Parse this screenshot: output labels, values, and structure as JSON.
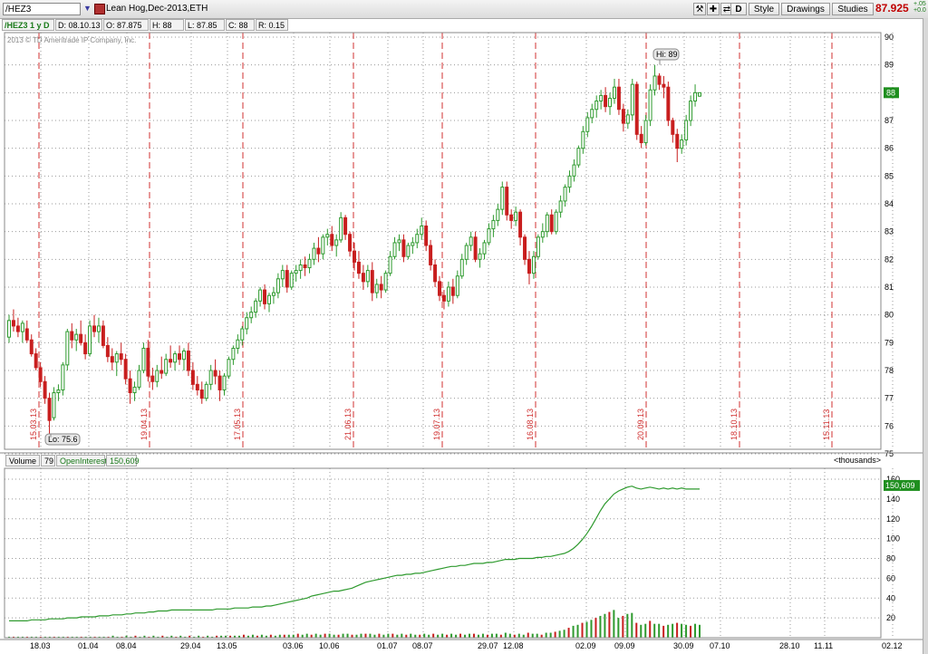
{
  "toolbar": {
    "symbol": "/HEZ3",
    "description": "Lean Hog,Dec-2013,ETH",
    "d_label": "D",
    "style_label": "Style",
    "drawings_label": "Drawings",
    "studies_label": "Studies",
    "last_price": "87.925",
    "change_top": "+.05",
    "change_bottom": "+0.0"
  },
  "info_bar": {
    "title": "/HEZ3 1 y D",
    "date": "D: 08.10.13",
    "open": "O: 87.875",
    "high": "H: 88",
    "low": "L: 87.85",
    "close": "C: 88",
    "range": "R: 0.15"
  },
  "copyright": "2013 © TD Ameritrade IP Company, Inc.",
  "price_panel": {
    "y_ticks": [
      "90",
      "89",
      "88",
      "87",
      "86",
      "85",
      "84",
      "83",
      "82",
      "81",
      "80",
      "79",
      "78",
      "77",
      "76",
      "75"
    ],
    "current_badge": "88",
    "hi_label": "Hi: 89",
    "lo_label": "Lo: 75.6",
    "expiry_labels": [
      "15.03.13",
      "19.04.13",
      "17.05.13",
      "21.06.13",
      "19.07.13",
      "16.08.13",
      "20.09.13",
      "18.10.13",
      "15.11.13"
    ]
  },
  "volume_panel": {
    "volume_label": "Volume",
    "volume_value": "79",
    "oi_label": "OpenInterest",
    "oi_value": "150,609",
    "thousands_label": "<thousands>",
    "oi_badge": "150,609",
    "y_ticks": [
      "160",
      "140",
      "120",
      "100",
      "80",
      "60",
      "40",
      "20"
    ]
  },
  "x_axis": [
    "18.03",
    "01.04",
    "08.04",
    "29.04",
    "13.05",
    "03.06",
    "10.06",
    "01.07",
    "08.07",
    "29.07",
    "12.08",
    "02.09",
    "09.09",
    "30.09",
    "07.10",
    "28.10",
    "11.11",
    "02.12"
  ],
  "colors": {
    "up": "#2e9a2e",
    "down": "#c81e1e",
    "oi_line": "#2e9a2e",
    "expiry": "#d03030",
    "badge": "#1f8f1f"
  },
  "chart_data": {
    "type": "candlestick",
    "price_ylim": [
      75,
      90
    ],
    "oi_ylim": [
      0,
      160
    ],
    "candles": [
      [
        79.2,
        80.0,
        79.0,
        79.8
      ],
      [
        79.8,
        80.2,
        79.4,
        79.6
      ],
      [
        79.6,
        79.9,
        79.2,
        79.4
      ],
      [
        79.4,
        79.8,
        79.0,
        79.7
      ],
      [
        79.5,
        79.8,
        79.0,
        79.1
      ],
      [
        79.1,
        79.3,
        78.5,
        78.6
      ],
      [
        78.6,
        78.8,
        78.0,
        78.1
      ],
      [
        78.1,
        78.3,
        77.4,
        77.6
      ],
      [
        77.6,
        77.8,
        76.8,
        77.0
      ],
      [
        77.0,
        77.2,
        75.6,
        76.2
      ],
      [
        76.3,
        77.4,
        76.2,
        77.2
      ],
      [
        77.2,
        77.5,
        76.9,
        77.3
      ],
      [
        77.3,
        78.3,
        77.1,
        78.2
      ],
      [
        78.2,
        79.5,
        78.0,
        79.4
      ],
      [
        79.4,
        79.7,
        78.8,
        79.1
      ],
      [
        79.1,
        79.5,
        78.7,
        79.3
      ],
      [
        79.3,
        79.8,
        78.9,
        79.0
      ],
      [
        79.0,
        79.3,
        78.4,
        78.6
      ],
      [
        78.6,
        79.8,
        78.5,
        79.6
      ],
      [
        79.6,
        80.0,
        79.2,
        79.4
      ],
      [
        79.4,
        79.9,
        79.0,
        79.6
      ],
      [
        79.6,
        79.8,
        78.8,
        78.9
      ],
      [
        78.9,
        79.2,
        78.3,
        78.5
      ],
      [
        78.5,
        78.8,
        78.0,
        78.3
      ],
      [
        78.3,
        78.7,
        77.8,
        78.6
      ],
      [
        78.6,
        79.0,
        78.2,
        78.4
      ],
      [
        78.4,
        78.6,
        77.5,
        77.7
      ],
      [
        77.7,
        78.0,
        76.8,
        77.2
      ],
      [
        77.2,
        77.6,
        76.9,
        77.4
      ],
      [
        77.4,
        78.2,
        77.3,
        78.0
      ],
      [
        78.0,
        79.0,
        77.9,
        78.8
      ],
      [
        78.8,
        79.1,
        77.6,
        77.8
      ],
      [
        77.8,
        78.1,
        77.3,
        77.6
      ],
      [
        77.6,
        78.2,
        77.4,
        78.0
      ],
      [
        78.0,
        78.5,
        77.7,
        77.9
      ],
      [
        77.9,
        78.6,
        77.8,
        78.4
      ],
      [
        78.4,
        78.9,
        78.1,
        78.3
      ],
      [
        78.3,
        78.7,
        78.0,
        78.6
      ],
      [
        78.6,
        78.9,
        78.2,
        78.4
      ],
      [
        78.4,
        78.8,
        78.0,
        78.7
      ],
      [
        78.7,
        79.0,
        77.8,
        78.0
      ],
      [
        78.0,
        78.3,
        77.3,
        77.5
      ],
      [
        77.5,
        77.8,
        77.1,
        77.3
      ],
      [
        77.3,
        77.6,
        76.8,
        77.0
      ],
      [
        77.0,
        77.6,
        76.9,
        77.5
      ],
      [
        77.5,
        78.2,
        77.3,
        78.0
      ],
      [
        78.0,
        78.4,
        77.5,
        77.8
      ],
      [
        77.8,
        78.0,
        76.9,
        77.3
      ],
      [
        77.3,
        77.9,
        77.1,
        77.8
      ],
      [
        77.8,
        78.5,
        77.7,
        78.4
      ],
      [
        78.4,
        78.9,
        78.2,
        78.8
      ],
      [
        78.8,
        79.3,
        78.6,
        79.1
      ],
      [
        79.1,
        79.6,
        78.9,
        79.5
      ],
      [
        79.5,
        80.1,
        79.3,
        79.9
      ],
      [
        79.9,
        80.3,
        79.7,
        80.1
      ],
      [
        80.1,
        80.6,
        79.9,
        80.5
      ],
      [
        80.5,
        81.0,
        80.3,
        80.9
      ],
      [
        80.9,
        81.1,
        80.2,
        80.4
      ],
      [
        80.4,
        80.8,
        80.1,
        80.7
      ],
      [
        80.7,
        81.0,
        80.4,
        80.8
      ],
      [
        80.8,
        81.5,
        80.6,
        81.3
      ],
      [
        81.3,
        81.8,
        81.0,
        81.6
      ],
      [
        81.6,
        81.8,
        80.8,
        81.0
      ],
      [
        81.0,
        81.6,
        80.9,
        81.5
      ],
      [
        81.5,
        81.8,
        81.2,
        81.6
      ],
      [
        81.6,
        82.0,
        81.3,
        81.8
      ],
      [
        81.8,
        82.1,
        81.4,
        81.7
      ],
      [
        81.7,
        82.2,
        81.5,
        82.0
      ],
      [
        82.0,
        82.6,
        81.8,
        82.4
      ],
      [
        82.4,
        82.8,
        81.9,
        82.2
      ],
      [
        82.2,
        82.9,
        82.0,
        82.8
      ],
      [
        82.8,
        83.1,
        82.5,
        82.9
      ],
      [
        82.9,
        83.2,
        82.3,
        82.5
      ],
      [
        82.5,
        82.9,
        82.1,
        82.7
      ],
      [
        82.7,
        83.7,
        82.6,
        83.5
      ],
      [
        83.5,
        83.6,
        82.7,
        82.9
      ],
      [
        82.9,
        83.0,
        82.1,
        82.3
      ],
      [
        82.3,
        82.6,
        81.6,
        81.9
      ],
      [
        81.9,
        82.3,
        81.3,
        81.5
      ],
      [
        81.5,
        81.8,
        80.9,
        81.2
      ],
      [
        81.2,
        81.8,
        81.0,
        81.6
      ],
      [
        81.6,
        81.9,
        80.5,
        80.8
      ],
      [
        80.8,
        81.3,
        80.6,
        81.1
      ],
      [
        81.1,
        81.4,
        80.6,
        80.9
      ],
      [
        80.9,
        81.6,
        80.8,
        81.5
      ],
      [
        81.5,
        82.3,
        81.4,
        82.1
      ],
      [
        82.1,
        82.8,
        82.0,
        82.6
      ],
      [
        82.6,
        82.9,
        82.3,
        82.7
      ],
      [
        82.7,
        82.9,
        81.9,
        82.1
      ],
      [
        82.1,
        82.6,
        82.0,
        82.5
      ],
      [
        82.5,
        82.8,
        82.2,
        82.6
      ],
      [
        82.6,
        83.1,
        82.4,
        82.9
      ],
      [
        82.9,
        83.5,
        82.7,
        83.2
      ],
      [
        83.2,
        83.4,
        82.3,
        82.5
      ],
      [
        82.5,
        82.7,
        81.6,
        81.8
      ],
      [
        81.8,
        82.0,
        81.0,
        81.2
      ],
      [
        81.2,
        81.4,
        80.5,
        80.7
      ],
      [
        80.7,
        80.9,
        80.2,
        80.5
      ],
      [
        80.5,
        81.2,
        80.3,
        81.0
      ],
      [
        81.0,
        81.3,
        80.4,
        80.7
      ],
      [
        80.7,
        81.6,
        80.6,
        81.4
      ],
      [
        81.4,
        82.2,
        81.3,
        82.0
      ],
      [
        82.0,
        82.6,
        81.8,
        82.5
      ],
      [
        82.5,
        83.0,
        82.3,
        82.8
      ],
      [
        82.8,
        83.0,
        81.9,
        82.0
      ],
      [
        82.0,
        82.4,
        81.7,
        82.2
      ],
      [
        82.2,
        82.7,
        82.0,
        82.6
      ],
      [
        82.6,
        83.3,
        82.5,
        83.1
      ],
      [
        83.1,
        83.6,
        82.8,
        83.4
      ],
      [
        83.4,
        84.0,
        83.2,
        83.8
      ],
      [
        83.8,
        84.8,
        83.6,
        84.6
      ],
      [
        84.6,
        84.8,
        83.4,
        83.6
      ],
      [
        83.6,
        83.8,
        83.1,
        83.4
      ],
      [
        83.4,
        83.9,
        83.2,
        83.7
      ],
      [
        83.7,
        83.8,
        82.5,
        82.8
      ],
      [
        82.8,
        82.9,
        81.8,
        82.0
      ],
      [
        82.0,
        82.3,
        81.1,
        81.5
      ],
      [
        81.5,
        82.3,
        81.3,
        82.1
      ],
      [
        82.1,
        82.9,
        82.0,
        82.8
      ],
      [
        82.8,
        83.3,
        82.6,
        83.0
      ],
      [
        83.0,
        83.7,
        82.8,
        83.6
      ],
      [
        83.6,
        83.8,
        82.9,
        83.0
      ],
      [
        83.0,
        83.8,
        82.9,
        83.7
      ],
      [
        83.7,
        84.3,
        83.5,
        84.1
      ],
      [
        84.1,
        84.7,
        83.9,
        84.6
      ],
      [
        84.6,
        85.2,
        84.4,
        85.0
      ],
      [
        85.0,
        85.6,
        84.8,
        85.4
      ],
      [
        85.4,
        86.1,
        85.3,
        86.0
      ],
      [
        86.0,
        86.8,
        85.8,
        86.6
      ],
      [
        86.6,
        87.3,
        86.4,
        87.1
      ],
      [
        87.1,
        87.6,
        86.9,
        87.4
      ],
      [
        87.4,
        87.9,
        87.1,
        87.7
      ],
      [
        87.7,
        88.1,
        87.4,
        87.9
      ],
      [
        87.9,
        88.2,
        87.3,
        87.5
      ],
      [
        87.5,
        88.0,
        87.2,
        87.8
      ],
      [
        87.8,
        88.5,
        87.6,
        88.2
      ],
      [
        88.2,
        88.5,
        87.2,
        87.4
      ],
      [
        87.4,
        87.6,
        86.6,
        86.9
      ],
      [
        86.9,
        87.4,
        86.7,
        87.2
      ],
      [
        87.2,
        88.5,
        87.0,
        88.3
      ],
      [
        88.3,
        88.4,
        86.3,
        86.5
      ],
      [
        86.5,
        86.8,
        86.0,
        86.2
      ],
      [
        86.2,
        87.2,
        86.1,
        87.0
      ],
      [
        87.0,
        88.3,
        86.8,
        88.1
      ],
      [
        88.1,
        89.0,
        87.9,
        88.6
      ],
      [
        88.6,
        88.7,
        88.1,
        88.3
      ],
      [
        88.3,
        88.6,
        87.8,
        88.2
      ],
      [
        88.2,
        88.4,
        86.8,
        87.0
      ],
      [
        87.0,
        87.1,
        86.2,
        86.5
      ],
      [
        86.5,
        86.7,
        85.5,
        86.0
      ],
      [
        86.0,
        86.5,
        85.8,
        86.3
      ],
      [
        86.3,
        87.2,
        86.1,
        87.0
      ],
      [
        87.0,
        87.9,
        86.8,
        87.7
      ],
      [
        87.7,
        88.3,
        87.5,
        88.0
      ],
      [
        87.875,
        88.0,
        87.85,
        88.0
      ]
    ],
    "open_interest": [
      17,
      17,
      17,
      17,
      17,
      18,
      18,
      18,
      18,
      19,
      19,
      19,
      19,
      20,
      20,
      20,
      21,
      21,
      21,
      21,
      22,
      22,
      22,
      23,
      23,
      23,
      24,
      24,
      25,
      25,
      25,
      26,
      26,
      27,
      27,
      27,
      28,
      28,
      28,
      28,
      28,
      28,
      28,
      28,
      28,
      28,
      29,
      29,
      29,
      29,
      30,
      30,
      30,
      30,
      31,
      31,
      31,
      32,
      32,
      33,
      34,
      35,
      36,
      37,
      38,
      39,
      40,
      42,
      43,
      44,
      45,
      46,
      47,
      47,
      48,
      49,
      50,
      52,
      54,
      56,
      57,
      58,
      59,
      60,
      61,
      62,
      63,
      63,
      64,
      64,
      65,
      65,
      66,
      67,
      68,
      69,
      70,
      71,
      72,
      72,
      73,
      73,
      74,
      75,
      75,
      75,
      76,
      76,
      77,
      78,
      79,
      79,
      79,
      80,
      80,
      80,
      80,
      81,
      81,
      82,
      82,
      83,
      84,
      85,
      87,
      90,
      94,
      99,
      105,
      112,
      120,
      128,
      135,
      140,
      145,
      148,
      150,
      152,
      153,
      151,
      150,
      151,
      152,
      151,
      150,
      151,
      150,
      151,
      150,
      151,
      150,
      150,
      150,
      150
    ],
    "volume": [
      1,
      1,
      1,
      1,
      1,
      1,
      1,
      1,
      1,
      1,
      1,
      1,
      1,
      1,
      1,
      1,
      1,
      1,
      1,
      1,
      1,
      1,
      1,
      2,
      1,
      1,
      2,
      1,
      2,
      1,
      2,
      1,
      2,
      1,
      2,
      1,
      2,
      1,
      2,
      1,
      2,
      1,
      2,
      1,
      2,
      1,
      2,
      2,
      2,
      2,
      2,
      2,
      3,
      2,
      3,
      2,
      3,
      2,
      3,
      2,
      3,
      3,
      3,
      3,
      4,
      3,
      4,
      3,
      4,
      3,
      4,
      4,
      3,
      3,
      4,
      4,
      3,
      3,
      4,
      4,
      4,
      3,
      4,
      3,
      4,
      4,
      3,
      4,
      3,
      4,
      3,
      3,
      4,
      3,
      4,
      3,
      4,
      3,
      4,
      3,
      4,
      3,
      4,
      4,
      3,
      4,
      3,
      4,
      4,
      3,
      5,
      4,
      3,
      4,
      3,
      5,
      4,
      4,
      3,
      5,
      5,
      6,
      7,
      8,
      10,
      12,
      13,
      15,
      16,
      18,
      20,
      22,
      24,
      26,
      28,
      20,
      22,
      24,
      25,
      15,
      13,
      14,
      17,
      14,
      14,
      12,
      13,
      14,
      15,
      14,
      13,
      12,
      14,
      13
    ]
  }
}
